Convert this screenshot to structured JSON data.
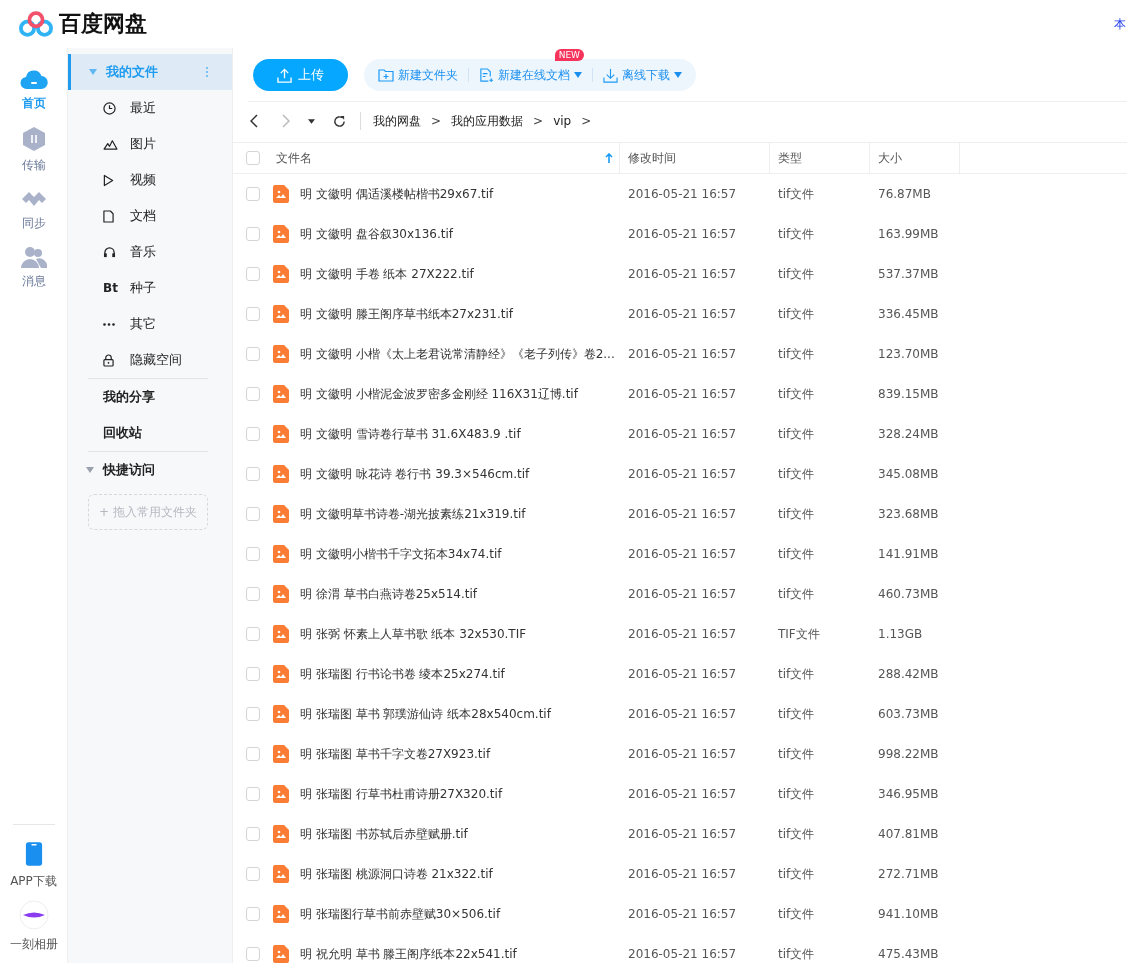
{
  "app": {
    "name": "百度网盘",
    "corner_text": "本"
  },
  "rail": {
    "items": [
      {
        "label": "首页",
        "kind": "home",
        "selected": true
      },
      {
        "label": "传输",
        "kind": "transfer",
        "selected": false
      },
      {
        "label": "同步",
        "kind": "sync",
        "selected": false
      },
      {
        "label": "消息",
        "kind": "messages",
        "selected": false
      }
    ],
    "bottom": [
      {
        "label": "APP下载",
        "kind": "phone"
      },
      {
        "label": "一刻相册",
        "kind": "album"
      }
    ]
  },
  "sidebar": {
    "my_files": {
      "label": "我的文件",
      "expanded": true,
      "selected": true,
      "children": [
        {
          "label": "最近",
          "kind": "recent"
        },
        {
          "label": "图片",
          "kind": "image"
        },
        {
          "label": "视频",
          "kind": "video"
        },
        {
          "label": "文档",
          "kind": "doc"
        },
        {
          "label": "音乐",
          "kind": "music"
        },
        {
          "label": "种子",
          "kind": "torrent",
          "glyph": "Bt"
        },
        {
          "label": "其它",
          "kind": "other"
        },
        {
          "label": "隐藏空间",
          "kind": "lock"
        }
      ]
    },
    "links": [
      "我的分享",
      "回收站"
    ],
    "quick_access": {
      "label": "快捷访问",
      "expanded": true,
      "drop_hint": "+ 拖入常用文件夹"
    }
  },
  "toolbar": {
    "upload": "上传",
    "actions": [
      {
        "label": "新建文件夹",
        "kind": "folder",
        "dropdown": false
      },
      {
        "label": "新建在线文档",
        "kind": "doc",
        "dropdown": true,
        "badge": "NEW"
      },
      {
        "label": "离线下载",
        "kind": "download",
        "dropdown": true
      }
    ]
  },
  "breadcrumb": {
    "separator": ">",
    "items": [
      "我的网盘",
      "我的应用数据",
      "vip"
    ]
  },
  "table": {
    "select_all_checked": false,
    "columns": [
      {
        "label": "文件名",
        "sorted": true,
        "descending": false
      },
      {
        "label": "修改时间"
      },
      {
        "label": "类型"
      },
      {
        "label": "大小"
      }
    ],
    "rows": [
      {
        "name": "明 文徽明 偶适溪楼帖楷书29x67.tif",
        "modified": "2016-05-21 16:57",
        "type": "tif文件",
        "size": "76.87MB",
        "checked": false
      },
      {
        "name": "明 文徽明 盘谷叙30x136.tif",
        "modified": "2016-05-21 16:57",
        "type": "tif文件",
        "size": "163.99MB",
        "checked": false
      },
      {
        "name": "明 文徽明 手卷 纸本 27X222.tif",
        "modified": "2016-05-21 16:57",
        "type": "tif文件",
        "size": "537.37MB",
        "checked": false
      },
      {
        "name": "明 文徽明 滕王阁序草书纸本27x231.tif",
        "modified": "2016-05-21 16:57",
        "type": "tif文件",
        "size": "336.45MB",
        "checked": false
      },
      {
        "name": "明 文徽明 小楷《太上老君说常清静经》《老子列传》卷2...",
        "modified": "2016-05-21 16:57",
        "type": "tif文件",
        "size": "123.70MB",
        "checked": false
      },
      {
        "name": "明 文徽明 小楷泥金波罗密多金刚经  116X31辽博.tif",
        "modified": "2016-05-21 16:57",
        "type": "tif文件",
        "size": "839.15MB",
        "checked": false
      },
      {
        "name": "明 文徽明 雪诗卷行草书 31.6X483.9 .tif",
        "modified": "2016-05-21 16:57",
        "type": "tif文件",
        "size": "328.24MB",
        "checked": false
      },
      {
        "name": "明 文徽明 咏花诗 卷行书 39.3×546cm.tif",
        "modified": "2016-05-21 16:57",
        "type": "tif文件",
        "size": "345.08MB",
        "checked": false
      },
      {
        "name": "明 文徽明草书诗卷-湖光披素练21x319.tif",
        "modified": "2016-05-21 16:57",
        "type": "tif文件",
        "size": "323.68MB",
        "checked": false
      },
      {
        "name": "明 文徽明小楷书千字文拓本34x74.tif",
        "modified": "2016-05-21 16:57",
        "type": "tif文件",
        "size": "141.91MB",
        "checked": false
      },
      {
        "name": "明 徐渭 草书白燕诗卷25x514.tif",
        "modified": "2016-05-21 16:57",
        "type": "tif文件",
        "size": "460.73MB",
        "checked": false
      },
      {
        "name": "明 张弼 怀素上人草书歌 纸本 32x530.TIF",
        "modified": "2016-05-21 16:57",
        "type": "TIF文件",
        "size": "1.13GB",
        "checked": false
      },
      {
        "name": "明 张瑞图  行书论书卷 绫本25x274.tif",
        "modified": "2016-05-21 16:57",
        "type": "tif文件",
        "size": "288.42MB",
        "checked": false
      },
      {
        "name": "明 张瑞图 草书 郭璞游仙诗 纸本28x540cm.tif",
        "modified": "2016-05-21 16:57",
        "type": "tif文件",
        "size": "603.73MB",
        "checked": false
      },
      {
        "name": "明 张瑞图 草书千字文卷27X923.tif",
        "modified": "2016-05-21 16:57",
        "type": "tif文件",
        "size": "998.22MB",
        "checked": false
      },
      {
        "name": "明 张瑞图 行草书杜甫诗册27X320.tif",
        "modified": "2016-05-21 16:57",
        "type": "tif文件",
        "size": "346.95MB",
        "checked": false
      },
      {
        "name": "明 张瑞图 书苏轼后赤壁赋册.tif",
        "modified": "2016-05-21 16:57",
        "type": "tif文件",
        "size": "407.81MB",
        "checked": false
      },
      {
        "name": "明 张瑞图 桃源洞口诗卷 21x322.tif",
        "modified": "2016-05-21 16:57",
        "type": "tif文件",
        "size": "272.71MB",
        "checked": false
      },
      {
        "name": "明 张瑞图行草书前赤壁赋30×506.tif",
        "modified": "2016-05-21 16:57",
        "type": "tif文件",
        "size": "941.10MB",
        "checked": false
      },
      {
        "name": "明 祝允明 草书 滕王阁序纸本22x541.tif",
        "modified": "2016-05-21 16:57",
        "type": "tif文件",
        "size": "475.43MB",
        "checked": false
      }
    ]
  }
}
